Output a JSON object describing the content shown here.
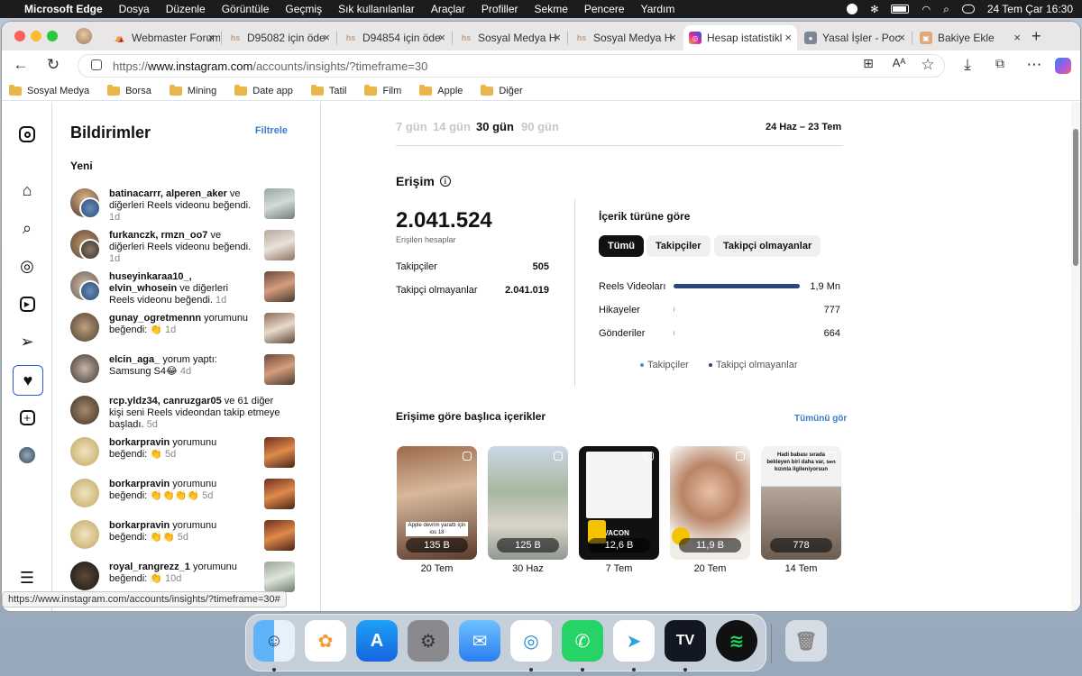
{
  "menubar": {
    "app": "Microsoft Edge",
    "items": [
      "Dosya",
      "Düzenle",
      "Görüntüle",
      "Geçmiş",
      "Sık kullanılanlar",
      "Araçlar",
      "Profiller",
      "Sekme",
      "Pencere",
      "Yardım"
    ],
    "clock": "24 Tem Çar  16:30"
  },
  "tabs": [
    {
      "label": "Webmaster Forum",
      "favicon": "W"
    },
    {
      "label": "D95082 için öde",
      "favicon": "hs"
    },
    {
      "label": "D94854 için öde",
      "favicon": "hs"
    },
    {
      "label": "Sosyal Medya H",
      "favicon": "hs"
    },
    {
      "label": "Sosyal Medya H",
      "favicon": "hs"
    },
    {
      "label": "Hesap istatistikl",
      "favicon": "ig"
    },
    {
      "label": "Yasal İşler - Poc",
      "favicon": "P"
    },
    {
      "label": "Bakiye Ekle",
      "favicon": "B"
    }
  ],
  "address": {
    "prefix": "https://",
    "domain": "www.instagram.com",
    "path": "/accounts/insights/?timeframe=30"
  },
  "bookmarks": [
    "Sosyal Medya",
    "Borsa",
    "Mining",
    "Date app",
    "Tatil",
    "Film",
    "Apple",
    "Diğer"
  ],
  "notifications": {
    "title": "Bildirimler",
    "filter": "Filtrele",
    "section": "Yeni",
    "items": [
      {
        "user": "batinacarrr, alperen_aker",
        "text": " ve diğerleri Reels videonu beğendi.",
        "time": "1d"
      },
      {
        "user": "furkanczk, rmzn_oo7",
        "text": " ve diğerleri Reels videonu beğendi.",
        "time": "1d"
      },
      {
        "user": "huseyinkaraa10_, elvin_whosein",
        "text": " ve diğerleri Reels videonu beğendi.",
        "time": "1d"
      },
      {
        "user": "gunay_ogretmennn",
        "text": " yorumunu beğendi: 👏",
        "time": "1d"
      },
      {
        "user": "elcin_aga_",
        "text": " yorum yaptı: Samsung S4😂",
        "time": "4d"
      },
      {
        "user": "rcp.yldz34, canruzgar05",
        "text": " ve 61 diğer kişi seni Reels videondan takip etmeye başladı.",
        "time": "5d"
      },
      {
        "user": "borkarpravin",
        "text": " yorumunu beğendi: 👏",
        "time": "5d"
      },
      {
        "user": "borkarpravin",
        "text": " yorumunu beğendi: 👏👏👏👏",
        "time": "5d"
      },
      {
        "user": "borkarpravin",
        "text": " yorumunu beğendi: 👏👏",
        "time": "5d"
      },
      {
        "user": "royal_rangrezz_1",
        "text": " yorumunu beğendi: 👏",
        "time": "10d"
      }
    ]
  },
  "insights": {
    "timeframes": [
      "7 gün",
      "14 gün",
      "30 gün",
      "90 gün"
    ],
    "active": "30 gün",
    "range": "24 Haz – 23 Tem",
    "reach_title": "Erişim",
    "reach_total": "2.041.524",
    "reach_sub": "Erişilen hesaplar",
    "followers_label": "Takipçiler",
    "followers_value": "505",
    "nonfollowers_label": "Takipçi olmayanlar",
    "nonfollowers_value": "2.041.019",
    "content_title": "İçerik türüne göre",
    "chips": [
      "Tümü",
      "Takipçiler",
      "Takipçi olmayanlar"
    ],
    "rows": [
      {
        "label": "Reels Videoları",
        "value": "1,9 Mn",
        "share": 1.0
      },
      {
        "label": "Hikayeler",
        "value": "777",
        "share": 0.0004
      },
      {
        "label": "Gönderiler",
        "value": "664",
        "share": 0.0003
      }
    ],
    "legend": [
      "Takipçiler",
      "Takipçi olmayanlar"
    ],
    "colors": {
      "followers": "#4a90d9",
      "nonfollowers": "#28477b"
    },
    "top_title": "Erişime göre başlıca içerikler",
    "top_link": "Tümünü gör",
    "cards": [
      {
        "count": "135 B",
        "date": "20 Tem",
        "caption": "Apple devrim yarattı için ios 18"
      },
      {
        "count": "125 B",
        "date": "30 Haz",
        "caption": ""
      },
      {
        "count": "12,6 B",
        "date": "7 Tem",
        "caption": "VIVACON"
      },
      {
        "count": "11,9 B",
        "date": "20 Tem",
        "caption": ""
      },
      {
        "count": "778",
        "date": "14 Tem",
        "caption": "Hadi babası sırada bekleyen biri daha var, sen kızınla ilgileniyorsun"
      }
    ]
  },
  "status_url": "https://www.instagram.com/accounts/insights/?timeframe=30#"
}
